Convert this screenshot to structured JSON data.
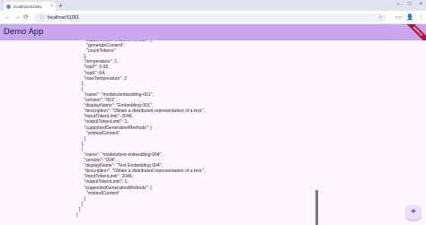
{
  "browser": {
    "tab_title": "localhost:51061",
    "tab_close_glyph": "×",
    "new_tab_glyph": "+",
    "window_controls": [
      "–",
      "□",
      "×"
    ],
    "url": "localhost:51061",
    "nav": {
      "back": "←",
      "forward": "→",
      "reload": "⟳"
    },
    "right_icons": [
      "☆",
      "▭",
      "👤",
      "⋮"
    ]
  },
  "app": {
    "title": "Demo App",
    "debug_banner": "DEBUG",
    "accent_color": "#c9a6f2",
    "fab_icon": "+"
  },
  "json_lines": [
    "      \"supportedGenerationMethods\": [",
    "        \"generateContent\",",
    "        \"countTokens\"",
    "      ],",
    "      \"temperature\": 1,",
    "      \"topP\": 0.95,",
    "      \"topK\": 64,",
    "      \"maxTemperature\": 2",
    "    },",
    "    {",
    "      \"name\": \"models/embedding-001\",",
    "      \"version\": \"001\",",
    "      \"displayName\": \"Embedding 001\",",
    "      \"description\": \"Obtain a distributed representation of a text.\",",
    "      \"inputTokenLimit\": 2048,",
    "      \"outputTokenLimit\": 1,",
    "      \"supportedGenerationMethods\": [",
    "        \"embedContent\"",
    "      ]",
    "    },",
    "    {",
    "      \"name\": \"models/text-embedding-004\",",
    "      \"version\": \"004\",",
    "      \"displayName\": \"Text Embedding 004\",",
    "      \"description\": \"Obtain a distributed representation of a text.\",",
    "      \"inputTokenLimit\": 2048,",
    "      \"outputTokenLimit\": 1,",
    "      \"supportedGenerationMethods\": [",
    "        \"embedContent\"",
    "      ]",
    "    }",
    "  ]",
    "}"
  ]
}
